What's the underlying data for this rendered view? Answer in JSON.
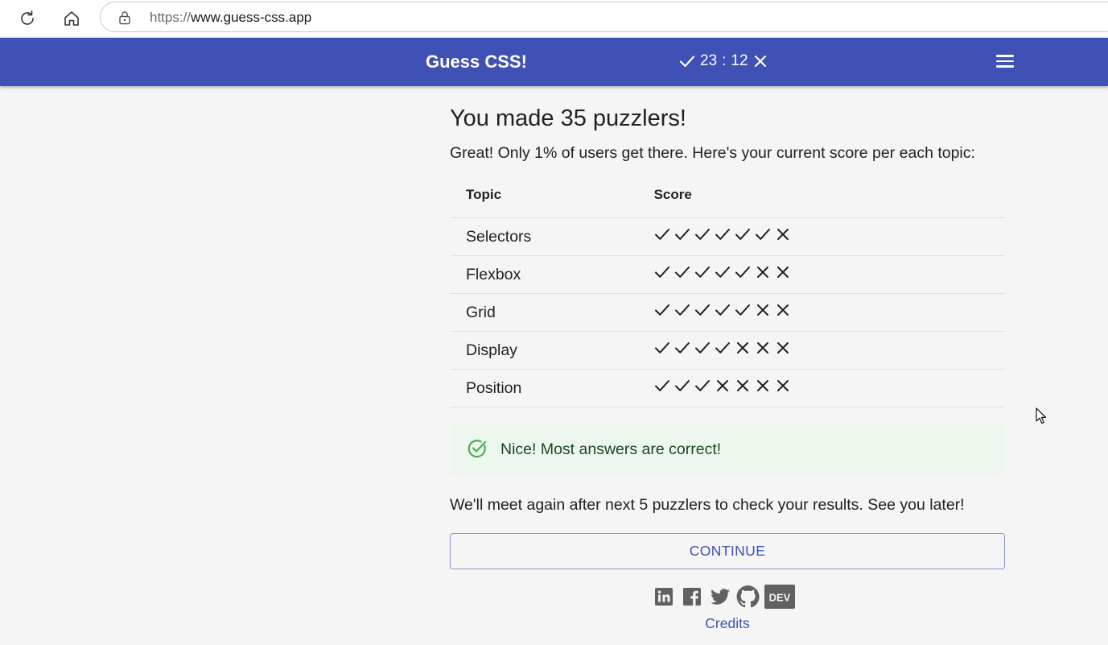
{
  "browser": {
    "url_scheme": "https://",
    "url_host": "www.guess-css.app"
  },
  "header": {
    "title": "Guess CSS!",
    "correct_count": "23",
    "separator": ":",
    "wrong_count": "12"
  },
  "results": {
    "headline": "You made 35 puzzlers!",
    "intro": "Great! Only 1% of users get there. Here's your current score per each topic:",
    "columns": [
      "Topic",
      "Score"
    ],
    "rows": [
      {
        "topic": "Selectors",
        "marks": [
          1,
          1,
          1,
          1,
          1,
          1,
          0
        ]
      },
      {
        "topic": "Flexbox",
        "marks": [
          1,
          1,
          1,
          1,
          1,
          0,
          0
        ]
      },
      {
        "topic": "Grid",
        "marks": [
          1,
          1,
          1,
          1,
          1,
          0,
          0
        ]
      },
      {
        "topic": "Display",
        "marks": [
          1,
          1,
          1,
          1,
          0,
          0,
          0
        ]
      },
      {
        "topic": "Position",
        "marks": [
          1,
          1,
          1,
          0,
          0,
          0,
          0
        ]
      }
    ],
    "alert_text": "Nice! Most answers are correct!",
    "meet_text": "We'll meet again after next 5 puzzlers to check your results. See you later!",
    "continue_label": "CONTINUE"
  },
  "footer": {
    "socials": [
      "linkedin-icon",
      "facebook-icon",
      "twitter-icon",
      "github-icon",
      "dev-icon"
    ],
    "dev_label": "DEV",
    "credits_label": "Credits"
  },
  "colors": {
    "primary": "#3f51b5",
    "background": "#f5f5f5",
    "success_bg": "#edf7ed",
    "success_icon": "#4caf50"
  }
}
